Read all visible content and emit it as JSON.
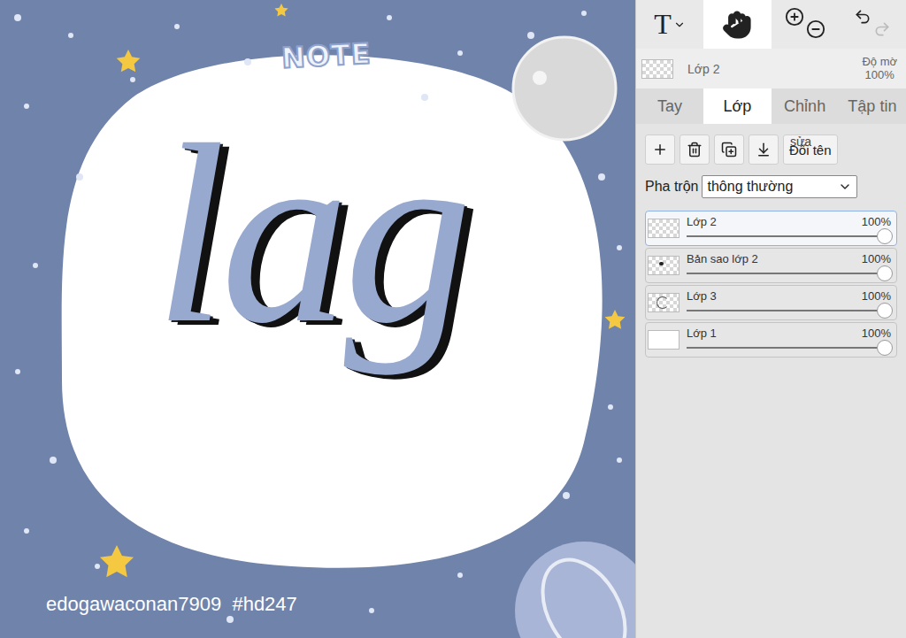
{
  "canvas": {
    "sticker": "NOTE",
    "lettering": "lag",
    "watermark": "edogawaconan7909  #hd247"
  },
  "toolbar": [
    {
      "kind": "text",
      "label": "T",
      "selected": false
    },
    {
      "kind": "hand",
      "selected": true
    },
    {
      "kind": "zoom",
      "selected": false
    },
    {
      "kind": "history",
      "selected": false,
      "redo_enabled": false
    }
  ],
  "current_layer": {
    "name": "Lớp 2",
    "opacity_label": "Độ mờ",
    "opacity": "100%"
  },
  "tabs": [
    {
      "label": "Tay",
      "selected": false
    },
    {
      "label": "Lớp",
      "selected": true
    },
    {
      "label": "Chỉnh",
      "selected": false
    },
    {
      "label": "Tập tin",
      "selected": false
    }
  ],
  "layer_buttons": [
    {
      "kind": "add"
    },
    {
      "kind": "delete"
    },
    {
      "kind": "duplicate"
    },
    {
      "kind": "merge"
    },
    {
      "kind": "rename",
      "label": "Đổi tên",
      "overlay": "sửa"
    }
  ],
  "blend": {
    "label": "Pha trộn",
    "value": "thông thường"
  },
  "layers": [
    {
      "name": "Lớp 2",
      "opacity": "100%",
      "level": 1,
      "selected": true,
      "thumb": "empty"
    },
    {
      "name": "Bản sao lớp 2",
      "opacity": "100%",
      "level": 1,
      "selected": false,
      "thumb": "mark"
    },
    {
      "name": "Lớp 3",
      "opacity": "100%",
      "level": 1,
      "selected": false,
      "thumb": "outline"
    },
    {
      "name": "Lớp 1",
      "opacity": "100%",
      "level": 1,
      "selected": false,
      "thumb": "white"
    }
  ]
}
